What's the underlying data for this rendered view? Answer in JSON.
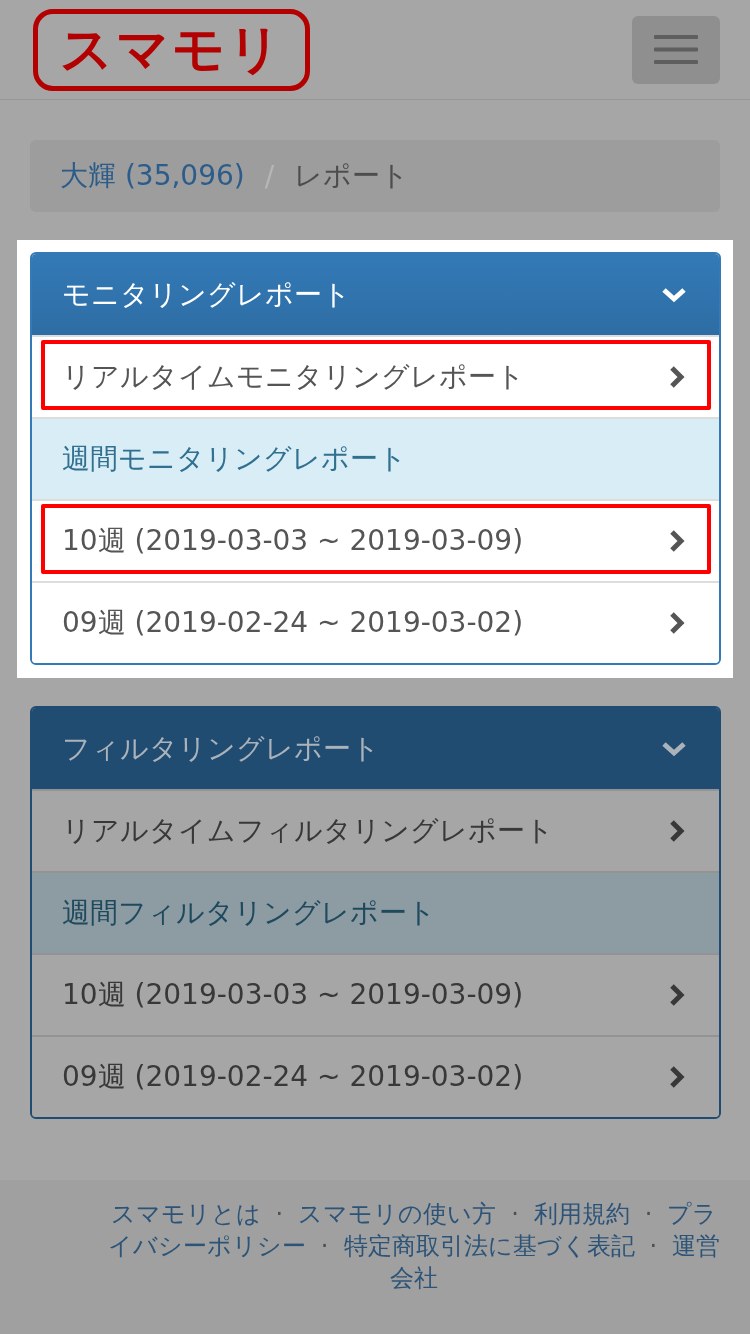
{
  "navbar": {
    "logo": "スマモリ"
  },
  "breadcrumb": {
    "separator": "/",
    "items": [
      {
        "label": "大輝 (35,096)",
        "current": false
      },
      {
        "label": "レポート",
        "current": true
      }
    ]
  },
  "panels": [
    {
      "title": "モニタリングレポート",
      "expanded": true,
      "spotlight": true,
      "items": [
        {
          "kind": "link",
          "label": "リアルタイムモニタリングレポート",
          "highlighted": true
        },
        {
          "kind": "heading",
          "label": "週間モニタリングレポート"
        },
        {
          "kind": "link",
          "label": "10週 (2019-03-03 ~ 2019-03-09)",
          "highlighted": true
        },
        {
          "kind": "link",
          "label": "09週 (2019-02-24 ~ 2019-03-02)",
          "highlighted": false
        }
      ]
    },
    {
      "title": "フィルタリングレポート",
      "expanded": true,
      "spotlight": false,
      "items": [
        {
          "kind": "link",
          "label": "リアルタイムフィルタリングレポート",
          "highlighted": false
        },
        {
          "kind": "heading",
          "label": "週間フィルタリングレポート"
        },
        {
          "kind": "link",
          "label": "10週 (2019-03-03 ~ 2019-03-09)",
          "highlighted": false
        },
        {
          "kind": "link",
          "label": "09週 (2019-02-24 ~ 2019-03-02)",
          "highlighted": false
        }
      ]
    }
  ],
  "footer": {
    "lines": [
      [
        {
          "kind": "link",
          "text": "スマモリとは"
        },
        {
          "kind": "separator",
          "text": "·"
        },
        {
          "kind": "link",
          "text": "スマモリの使い方"
        },
        {
          "kind": "separator",
          "text": "·"
        },
        {
          "kind": "link",
          "text": "利用規約"
        },
        {
          "kind": "separator",
          "text": "·"
        },
        {
          "kind": "link",
          "text": "プラ"
        }
      ],
      [
        {
          "kind": "link",
          "text": "イバシーポリシー"
        },
        {
          "kind": "separator",
          "text": "·"
        },
        {
          "kind": "link",
          "text": "特定商取引法に基づく表記"
        },
        {
          "kind": "separator",
          "text": "·"
        },
        {
          "kind": "link",
          "text": "運営"
        }
      ],
      [
        {
          "kind": "link",
          "text": "会社"
        }
      ]
    ]
  }
}
